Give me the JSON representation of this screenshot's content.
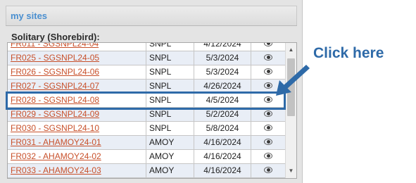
{
  "panel": {
    "title": "my sites",
    "group_label": "Solitary (Shorebird):"
  },
  "sites": [
    {
      "name": "FR011 - SGSNPL24-04",
      "type": "SNPL",
      "date": "4/12/2024"
    },
    {
      "name": "FR025 - SGSNPL24-05",
      "type": "SNPL",
      "date": "5/3/2024"
    },
    {
      "name": "FR026 - SGSNPL24-06",
      "type": "SNPL",
      "date": "5/3/2024"
    },
    {
      "name": "FR027 - SGSNPL24-07",
      "type": "SNPL",
      "date": "4/26/2024"
    },
    {
      "name": "FR028 - SGSNPL24-08",
      "type": "SNPL",
      "date": "4/5/2024"
    },
    {
      "name": "FR029 - SGSNPL24-09",
      "type": "SNPL",
      "date": "5/2/2024"
    },
    {
      "name": "FR030 - SGSNPL24-10",
      "type": "SNPL",
      "date": "5/8/2024"
    },
    {
      "name": "FR031 - AHAMOY24-01",
      "type": "AMOY",
      "date": "4/16/2024"
    },
    {
      "name": "FR032 - AHAMOY24-02",
      "type": "AMOY",
      "date": "4/16/2024"
    },
    {
      "name": "FR033 - AHAMOY24-03",
      "type": "AMOY",
      "date": "4/16/2024"
    }
  ],
  "callout": {
    "text": "Click here"
  },
  "icons": {
    "view": "eye-icon",
    "scroll_up": "triangle-up",
    "scroll_down": "triangle-down"
  },
  "colors": {
    "link": "#c8502a",
    "accent": "#2e6aa8",
    "title": "#4a8fd0"
  }
}
